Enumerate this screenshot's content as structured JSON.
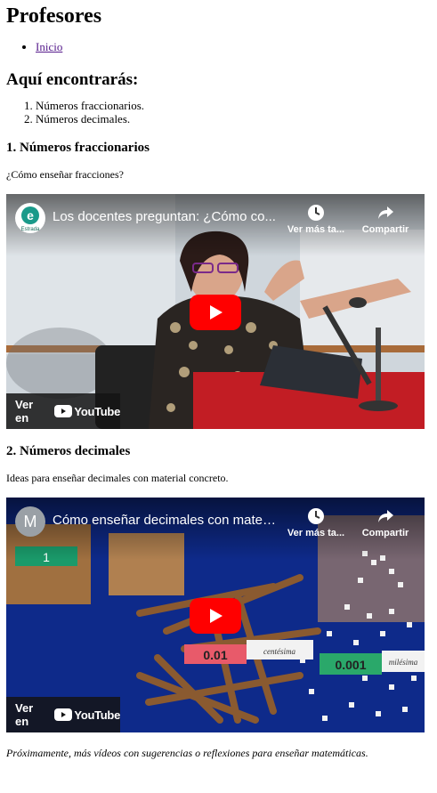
{
  "page": {
    "title": "Profesores",
    "nav": [
      {
        "label": "Inicio"
      }
    ],
    "intro_heading": "Aquí encontrarás:",
    "topics": [
      "Números fraccionarios.",
      "Números decimales."
    ],
    "footer_note": "Próximamente, más vídeos con sugerencias o reflexiones para enseñar matemáticas."
  },
  "sections": [
    {
      "heading": "1. Números fraccionarios",
      "description": "¿Cómo enseñar fracciones?",
      "video": {
        "title": "Los docentes preguntan: ¿Cómo co...",
        "channel_logo": "e",
        "channel_name": "Estrada",
        "watch_later_label": "Ver más ta...",
        "share_label": "Compartir",
        "watch_on_label": "Ver en",
        "platform": "YouTube"
      }
    },
    {
      "heading": "2. Números decimales",
      "description": "Ideas para enseñar decimales con material concreto.",
      "video": {
        "title": "Cómo enseñar decimales con mater...",
        "channel_logo": "M",
        "watch_later_label": "Ver más ta...",
        "share_label": "Compartir",
        "watch_on_label": "Ver en",
        "platform": "YouTube",
        "tag_hundredth_value": "0.01",
        "tag_hundredth_word": "centésima",
        "tag_thousandth_value": "0.001",
        "tag_thousandth_word": "milésima",
        "cube_label": "1"
      }
    }
  ],
  "colors": {
    "link": "#551a8b",
    "youtube_red": "#ff0000",
    "channel1_logo": "#1a9a8a",
    "channel2_logo": "#9aa0a6"
  }
}
